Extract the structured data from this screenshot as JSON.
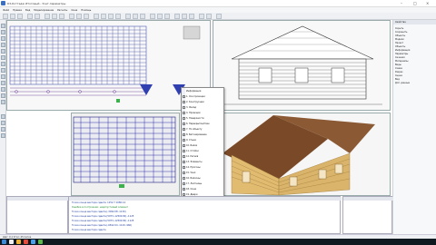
{
  "titlebar": {
    "title": "К3-Коттедж Итоговый - Учет-параметры"
  },
  "menubar": {
    "items": [
      "Файл",
      "Правка",
      "Вид",
      "Моделирование",
      "Расчеты",
      "Окна",
      "Помощь"
    ]
  },
  "context_menu": {
    "items": [
      "Информация",
      "1. Оси проекции",
      "2. Конструкции",
      "3. Фасад",
      "4. Проекции",
      "5. Поверхности",
      "6. Перекрытие/план",
      "7. По объекту",
      "8. Бетонирование",
      "9. Стыки",
      "10. Балки",
      "11. Стойки",
      "12. Ригеля",
      "13. Элементы",
      "14. Прогоны",
      "15. Узел",
      "16. Балконы",
      "17. Лестницы",
      "18. Окна",
      "19. Двери",
      "20. Проемы",
      "Копировать",
      "Вставить",
      "Удалить",
      "Свойства"
    ]
  },
  "right_panel": {
    "header": "Свойства",
    "items": [
      "Скрыть",
      "Сохранить",
      "Объекты",
      "Модели",
      "Проект",
      "Объекты",
      "Информация",
      "Параметры",
      "Сечения",
      "Материалы",
      "Виды",
      "Схема",
      "Разрез",
      "Сцена",
      "Вид",
      "Доп. данные"
    ]
  },
  "log": {
    "lines": [
      "Точка конца вектора сдвига: 1252.7 1080.14",
      "Ошибка в построении: недопустимый элемент",
      "Точка конца вектора сдвига:(-3094.58 -1130)",
      "Точка конца вектора сдвига:(5973,-12500.84) -1125",
      "Точка конца вектора сдвига:(5973,-12500.84) -1125",
      "Точка конца вектора сдвига:(-6812.04 -1129 -960)",
      "Точка конца вектора сдвига"
    ]
  },
  "statusbar": {
    "text": "Шаг: 0.1 Угол: 45 Сетка"
  },
  "colors": {
    "accent": "#2a3aa0",
    "wood": "#d9b46a",
    "roof": "#7a4a28",
    "taskbar": "#101820"
  }
}
